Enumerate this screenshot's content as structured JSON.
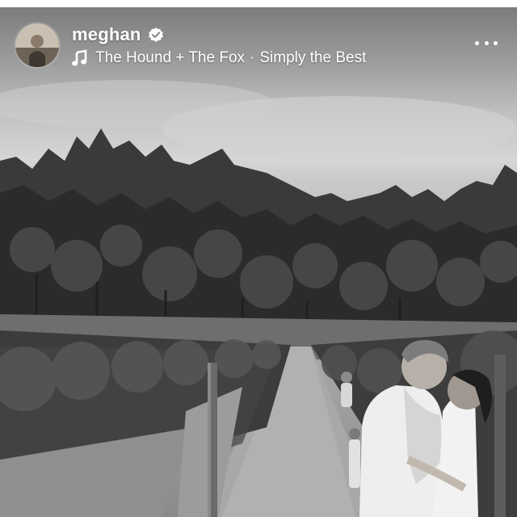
{
  "post": {
    "username": "meghan",
    "verified": true,
    "audio": {
      "artist": "The Hound + The Fox",
      "separator": "·",
      "title": "Simply the Best"
    }
  },
  "icons": {
    "verified": "verified-badge-icon",
    "music": "music-note-icon",
    "more": "more-horizontal-icon"
  },
  "colors": {
    "overlay_text": "#ffffff",
    "photo_tone": "grayscale"
  }
}
